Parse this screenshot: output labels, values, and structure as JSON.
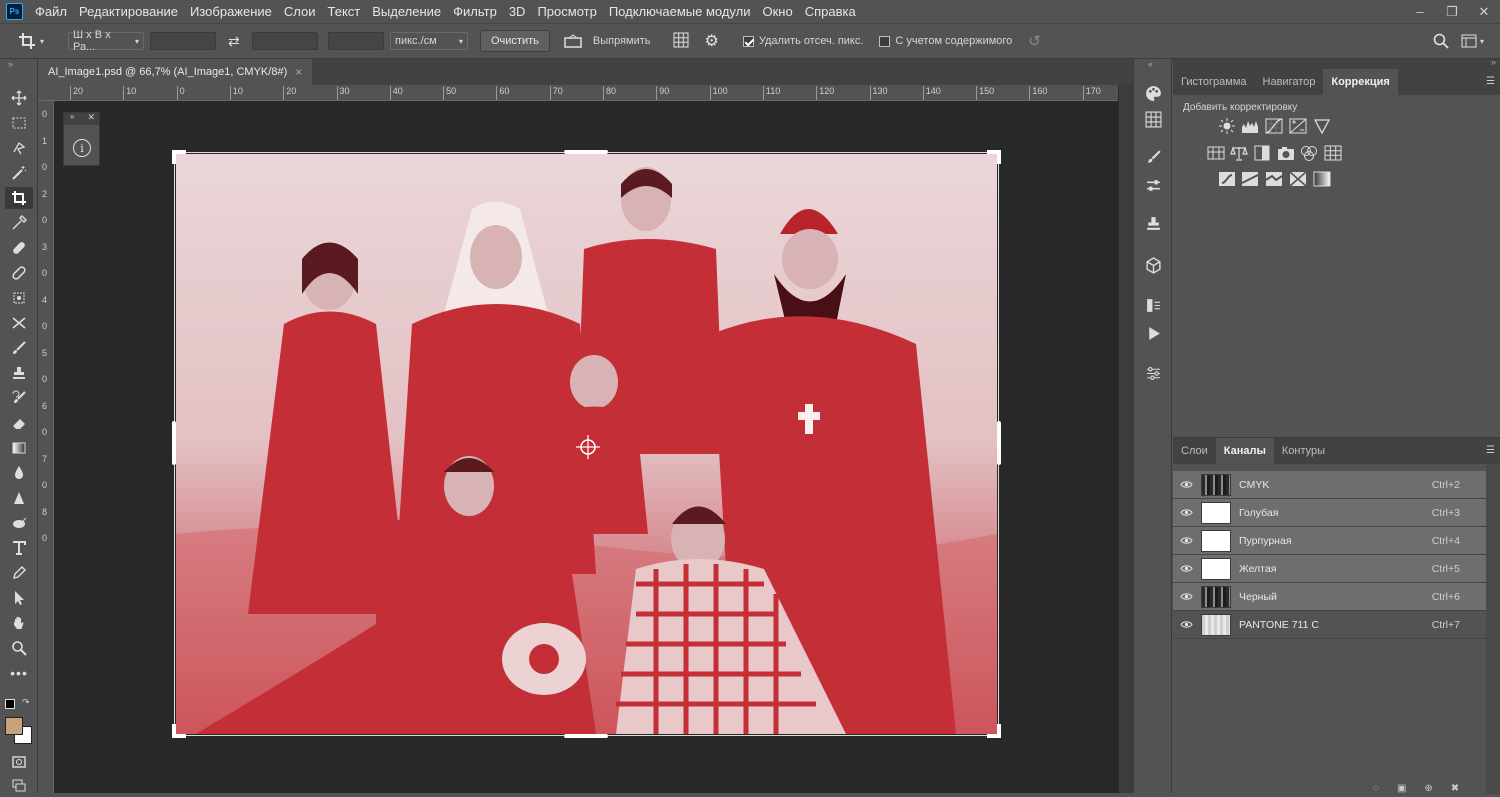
{
  "app": {
    "logo": "Ps"
  },
  "menu": [
    "Файл",
    "Редактирование",
    "Изображение",
    "Слои",
    "Текст",
    "Выделение",
    "Фильтр",
    "3D",
    "Просмотр",
    "Подключаемые модули",
    "Окно",
    "Справка"
  ],
  "options": {
    "ratio": "Ш x В x Ра...",
    "units": "пикс./см",
    "clear": "Очистить",
    "straighten": "Выпрямить",
    "delete_cropped": "Удалить отсеч. пикс.",
    "content_aware": "С учетом содержимого"
  },
  "document": {
    "tab_title": "AI_Image1.psd @ 66,7% (AI_Image1, CMYK/8#)",
    "close": "×"
  },
  "ruler": {
    "h_ticks": [
      "20",
      "10",
      "0",
      "10",
      "20",
      "30",
      "40",
      "50",
      "60",
      "70",
      "80",
      "90",
      "100",
      "110",
      "120",
      "130",
      "140",
      "150",
      "160",
      "170"
    ],
    "v_ticks": [
      "0",
      "1",
      "0",
      "2",
      "0",
      "3",
      "0",
      "4",
      "0",
      "5",
      "0",
      "6",
      "0",
      "7",
      "0",
      "8",
      "0"
    ]
  },
  "top_panel": {
    "tabs": [
      "Гистограмма",
      "Навигатор",
      "Коррекция"
    ],
    "active": "Коррекция",
    "add_adjustment": "Добавить корректировку"
  },
  "channels_panel": {
    "tabs": [
      "Слои",
      "Каналы",
      "Контуры"
    ],
    "active": "Каналы",
    "channels": [
      {
        "name": "CMYK",
        "shortcut": "Ctrl+2",
        "thumb": "photo"
      },
      {
        "name": "Голубая",
        "shortcut": "Ctrl+3",
        "thumb": "white"
      },
      {
        "name": "Пурпурная",
        "shortcut": "Ctrl+4",
        "thumb": "white"
      },
      {
        "name": "Желтая",
        "shortcut": "Ctrl+5",
        "thumb": "white"
      },
      {
        "name": "Черный",
        "shortcut": "Ctrl+6",
        "thumb": "photo"
      },
      {
        "name": "PANTONE 711 C",
        "shortcut": "Ctrl+7",
        "thumb": "light"
      }
    ]
  },
  "colors": {
    "foreground": "#c8a27c",
    "background": "#ffffff",
    "photo_tint": "#c42e37"
  }
}
